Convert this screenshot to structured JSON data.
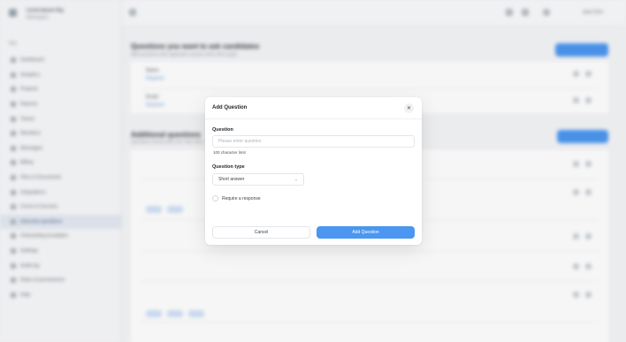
{
  "background_app": {
    "sidebar": {
      "org_name": "Lorem Ipsum Org",
      "org_sub": "Workspace",
      "section_label": "App",
      "items": [
        {
          "label": "Dashboard"
        },
        {
          "label": "Analytics"
        },
        {
          "label": "Projects"
        },
        {
          "label": "Reports"
        },
        {
          "label": "Teams"
        },
        {
          "label": "Members"
        },
        {
          "label": "Messages"
        },
        {
          "label": "Billing"
        },
        {
          "label": "Files & Documents"
        },
        {
          "label": "Integrations"
        },
        {
          "label": "Forms & Surveys"
        },
        {
          "label": "Interview questions"
        },
        {
          "label": "Onboarding templates"
        },
        {
          "label": "Settings"
        },
        {
          "label": "Audit log"
        },
        {
          "label": "Roles & permissions"
        },
        {
          "label": "Help"
        }
      ]
    },
    "topbar": {
      "user": "Jane Doe"
    },
    "sections": [
      {
        "title": "Questions you want to ask candidates",
        "subtitle": "Add questions that applicants answer when they apply"
      },
      {
        "title": "Additional questions",
        "subtitle": "Questions shown after the main form"
      }
    ]
  },
  "modal": {
    "title": "Add Question",
    "close_icon": "close-icon",
    "question_label": "Question",
    "question_placeholder": "Please enter question",
    "question_value": "",
    "char_limit_hint": "100 character limit",
    "question_type_label": "Question type",
    "question_type_selected": "Short answer",
    "require_label": "Require a response",
    "require_checked": false,
    "cancel_label": "Cancel",
    "add_label": "Add Question"
  },
  "colors": {
    "accent": "#4a96f0",
    "modal_bg": "#ffffff",
    "page_bg": "#f4f5f7"
  }
}
